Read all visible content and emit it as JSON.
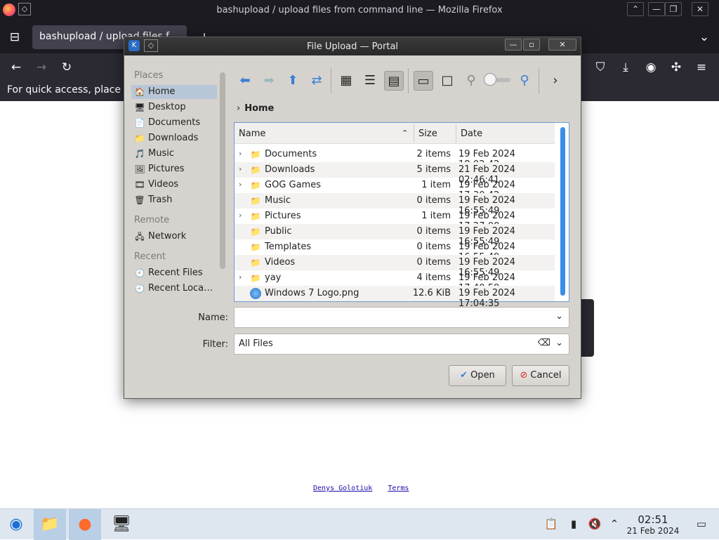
{
  "firefox": {
    "window_title": "bashupload / upload files from command line — Mozilla Firefox",
    "tab_title": "bashupload / upload files f",
    "bookmarks_hint": "For quick access, place yo"
  },
  "page": {
    "footer_links": [
      "Denys Golotiuk",
      "Terms"
    ]
  },
  "dialog": {
    "title": "File Upload — Portal",
    "places_heading": "Places",
    "places": [
      {
        "label": "Home",
        "icon": "home-icon",
        "selected": true
      },
      {
        "label": "Desktop",
        "icon": "desktop-icon"
      },
      {
        "label": "Documents",
        "icon": "documents-icon"
      },
      {
        "label": "Downloads",
        "icon": "downloads-icon"
      },
      {
        "label": "Music",
        "icon": "music-icon"
      },
      {
        "label": "Pictures",
        "icon": "pictures-icon"
      },
      {
        "label": "Videos",
        "icon": "videos-icon"
      },
      {
        "label": "Trash",
        "icon": "trash-icon"
      }
    ],
    "remote_heading": "Remote",
    "remote": [
      {
        "label": "Network",
        "icon": "network-icon"
      }
    ],
    "recent_heading": "Recent",
    "recent": [
      {
        "label": "Recent Files",
        "icon": "recent-files-icon"
      },
      {
        "label": "Recent Loca…",
        "icon": "recent-locations-icon"
      }
    ],
    "breadcrumb": "Home",
    "columns": {
      "name": "Name",
      "size": "Size",
      "date": "Date"
    },
    "files": [
      {
        "name": "Documents",
        "size": "2 items",
        "date": "19 Feb 2024 18:02:42",
        "expandable": true,
        "icon": "folder-icon"
      },
      {
        "name": "Downloads",
        "size": "5 items",
        "date": "21 Feb 2024 02:46:41",
        "expandable": true,
        "icon": "folder-icon"
      },
      {
        "name": "GOG Games",
        "size": "1 item",
        "date": "19 Feb 2024 17:30:42",
        "expandable": true,
        "icon": "folder-icon"
      },
      {
        "name": "Music",
        "size": "0 items",
        "date": "19 Feb 2024 16:55:49",
        "expandable": false,
        "icon": "folder-icon"
      },
      {
        "name": "Pictures",
        "size": "1 item",
        "date": "19 Feb 2024 17:27:00",
        "expandable": true,
        "icon": "folder-icon"
      },
      {
        "name": "Public",
        "size": "0 items",
        "date": "19 Feb 2024 16:55:49",
        "expandable": false,
        "icon": "folder-icon"
      },
      {
        "name": "Templates",
        "size": "0 items",
        "date": "19 Feb 2024 16:55:49",
        "expandable": false,
        "icon": "folder-icon"
      },
      {
        "name": "Videos",
        "size": "0 items",
        "date": "19 Feb 2024 16:55:49",
        "expandable": false,
        "icon": "folder-icon"
      },
      {
        "name": "yay",
        "size": "4 items",
        "date": "19 Feb 2024 17:40:59",
        "expandable": true,
        "icon": "folder-icon"
      },
      {
        "name": "Windows 7 Logo.png",
        "size": "12.6 KiB",
        "date": "19 Feb 2024 17:04:35",
        "expandable": false,
        "icon": "image-file-icon"
      }
    ],
    "name_label": "Name:",
    "name_value": "",
    "filter_label": "Filter:",
    "filter_value": "All Files",
    "open_button": "Open",
    "cancel_button": "Cancel"
  },
  "taskbar": {
    "time": "02:51",
    "date": "21 Feb 2024"
  },
  "colors": {
    "firefox_dark": "#1c1b22",
    "dialog_bg": "#d6d3ce",
    "selection": "#b8c7d7",
    "accent_blue": "#3b8ee8",
    "taskbar_bg": "#dee6ef"
  }
}
